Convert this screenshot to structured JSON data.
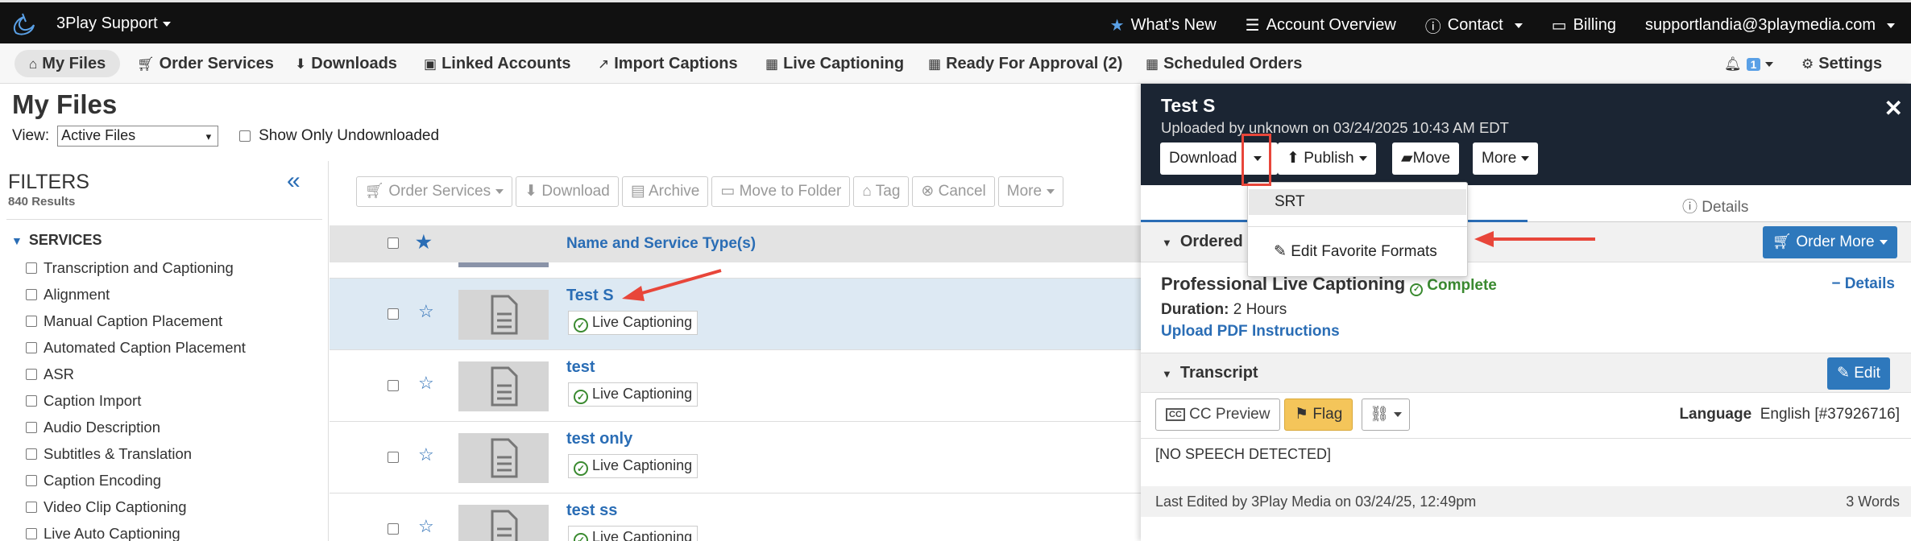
{
  "topbar": {
    "brand": "3Play Support",
    "whats_new": "What's New",
    "account_overview": "Account Overview",
    "contact": "Contact",
    "billing": "Billing",
    "email": "supportlandia@3playmedia.com"
  },
  "nav": {
    "my_files": "My Files",
    "order_services": "Order Services",
    "downloads": "Downloads",
    "linked_accounts": "Linked Accounts",
    "import_captions": "Import Captions",
    "live_captioning": "Live Captioning",
    "ready_for_approval": "Ready For Approval (2)",
    "scheduled_orders": "Scheduled Orders",
    "notif_count": "1",
    "settings": "Settings"
  },
  "page": {
    "title": "My Files",
    "view_label": "View:",
    "view_value": "Active Files",
    "show_undownloaded": "Show Only Undownloaded"
  },
  "filters": {
    "title": "FILTERS",
    "count": "840 Results",
    "services_label": "SERVICES",
    "items": [
      "Transcription and Captioning",
      "Alignment",
      "Manual Caption Placement",
      "Automated Caption Placement",
      "ASR",
      "Caption Import",
      "Audio Description",
      "Subtitles & Translation",
      "Caption Encoding",
      "Video Clip Captioning",
      "Live Auto Captioning"
    ]
  },
  "toolbar": {
    "order_services": "Order Services",
    "download": "Download",
    "archive": "Archive",
    "move_to_folder": "Move to Folder",
    "tag": "Tag",
    "cancel": "Cancel",
    "more": "More"
  },
  "table": {
    "header_name": "Name and Service Type(s)",
    "rows": [
      {
        "name": "Test S",
        "service": "Live Captioning"
      },
      {
        "name": "test",
        "service": "Live Captioning"
      },
      {
        "name": "test only",
        "service": "Live Captioning"
      },
      {
        "name": "test ss",
        "service": "Live Captioning"
      }
    ]
  },
  "panel": {
    "title": "Test S",
    "subtitle": "Uploaded by unknown on 03/24/2025 10:43 AM EDT",
    "download": "Download",
    "publish": "Publish",
    "move": "Move",
    "more": "More",
    "details_tab": "Details",
    "ordered_label": "Ordered",
    "order_more": "Order More",
    "service_name": "Professional Live Captioning",
    "status": "Complete",
    "details_link": "Details",
    "duration_label": "Duration:",
    "duration_value": "2 Hours",
    "upload_pdf": "Upload PDF Instructions",
    "transcript_label": "Transcript",
    "edit": "Edit",
    "cc_preview": "CC Preview",
    "flag": "Flag",
    "language_label": "Language",
    "language_value": "English [#37926716]",
    "transcript_text": "[NO SPEECH DETECTED]",
    "last_edited": "Last Edited by 3Play Media on 03/24/25, 12:49pm",
    "word_count": "3 Words"
  },
  "dropdown": {
    "srt": "SRT",
    "edit_favorites": "Edit Favorite Formats"
  },
  "colors": {
    "accent": "#2a6db5",
    "annotation": "#e8463a",
    "panel_header": "#1b2533"
  }
}
